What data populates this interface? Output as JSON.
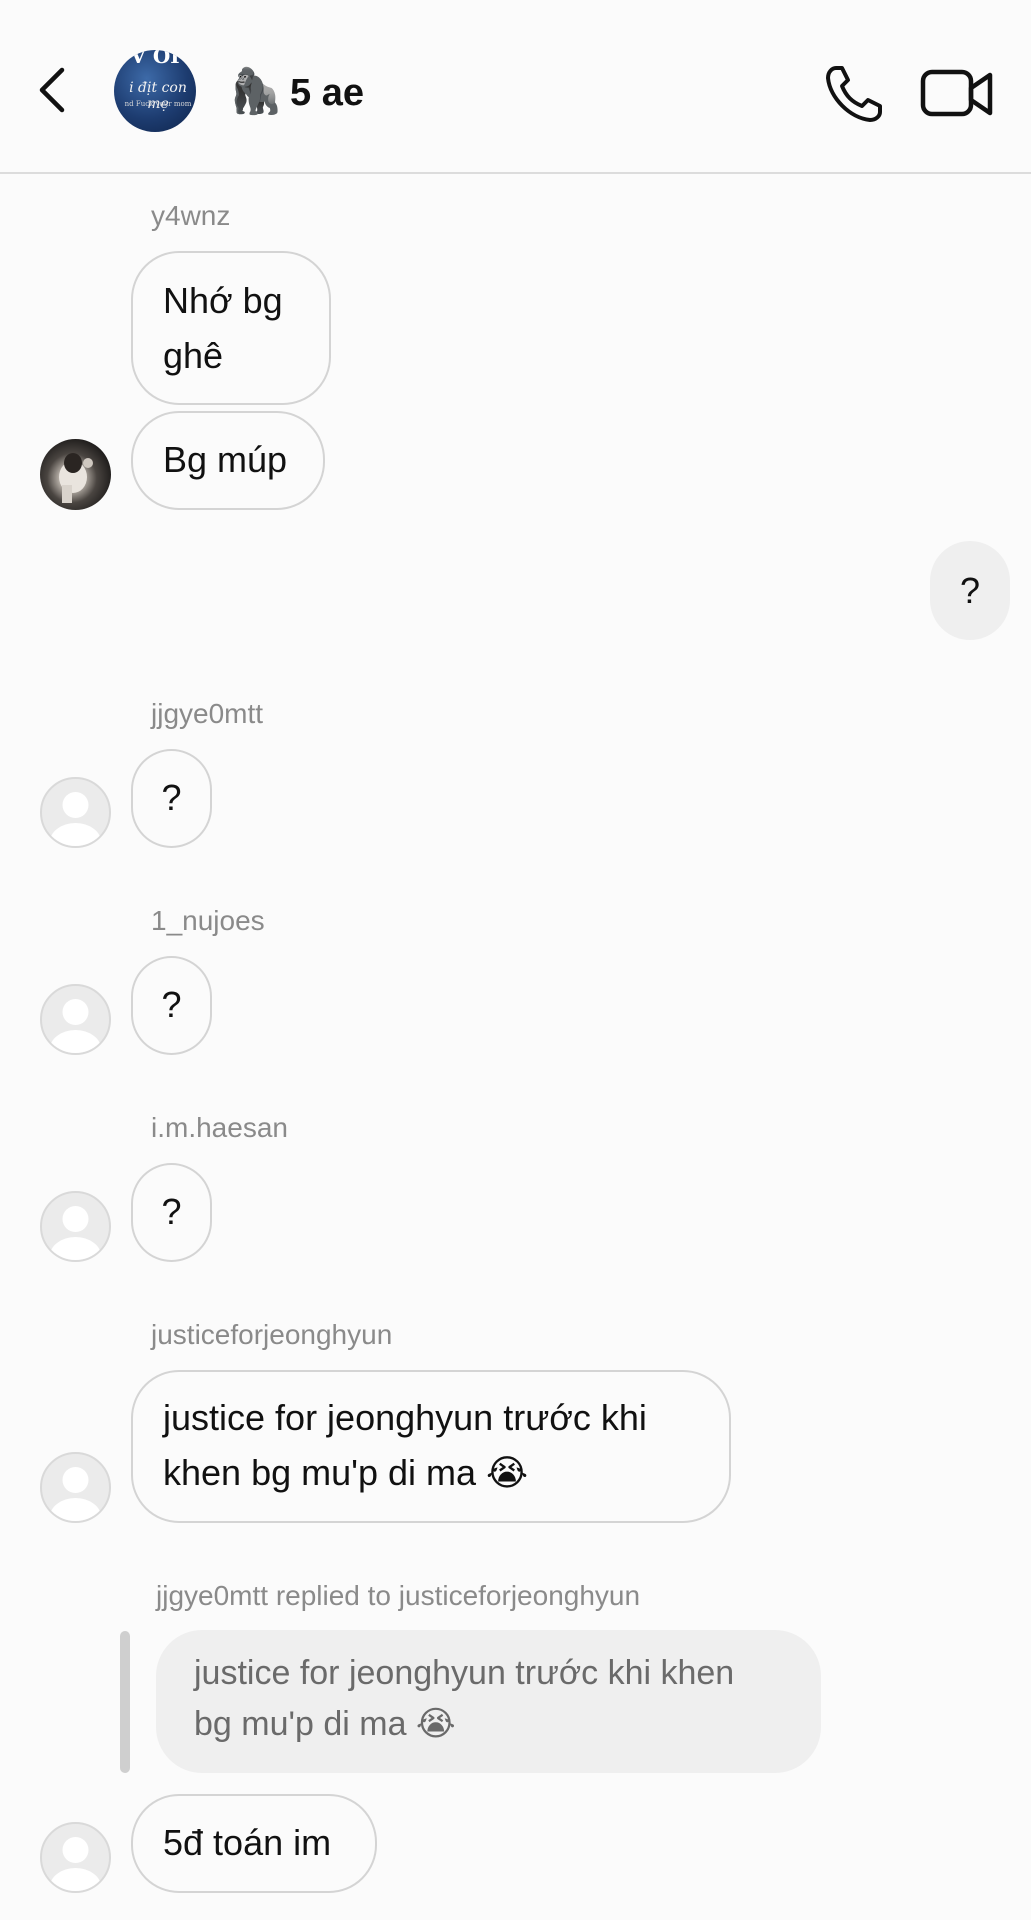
{
  "header": {
    "title_emoji": "🦍",
    "title": "5 ae",
    "avatar_line1": "V OI",
    "avatar_line2": "i địt con mẹ",
    "avatar_line3": "nd Fuck your mom"
  },
  "messages": {
    "m1_sender": "y4wnz",
    "m1_line1": "Nhớ bg",
    "m1_line2": "ghê",
    "m2_text": "Bg múp",
    "mine_text": "?",
    "m3_sender": "jjgye0mtt",
    "m3_text": "?",
    "m4_sender": "1_nujoes",
    "m4_text": "?",
    "m5_sender": "i.m.haesan",
    "m5_text": "?",
    "m6_sender": "justiceforjeonghyun",
    "m6_line1": "justice for jeonghyun trước khi",
    "m6_line2": "khen bg mu'p di ma 😭",
    "reply_meta": "jjgye0mtt replied to justiceforjeonghyun",
    "reply_quote_line1": "justice for jeonghyun trước khi khen",
    "reply_quote_line2": "bg mu'p di ma 😭",
    "m7_text": "5đ toán im"
  },
  "icons": {
    "back": "chevron-left-icon",
    "call": "phone-icon",
    "video": "video-camera-icon",
    "default_avatar": "person-silhouette-icon"
  },
  "colors": {
    "background": "#fbfbfb",
    "bubble_border": "#d4d4d4",
    "my_bubble": "#efefef",
    "sender_text": "#8a8a8a"
  }
}
